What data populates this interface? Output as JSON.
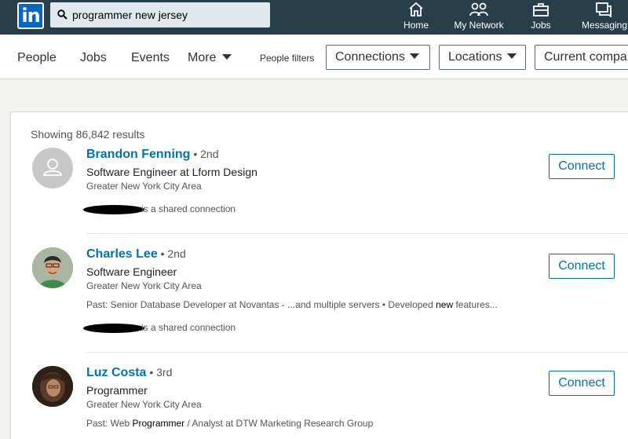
{
  "topnav": {
    "logo": "in",
    "search": {
      "value": "programmer new jersey"
    },
    "items": [
      {
        "label": "Home",
        "icon": "home-icon"
      },
      {
        "label": "My Network",
        "icon": "network-icon"
      },
      {
        "label": "Jobs",
        "icon": "briefcase-icon"
      },
      {
        "label": "Messaging",
        "icon": "messaging-icon"
      }
    ]
  },
  "subnav": {
    "tabs": [
      "People",
      "Jobs",
      "Events",
      "More"
    ],
    "filters_label": "People filters",
    "dropdowns": [
      "Connections",
      "Locations",
      "Current compa"
    ]
  },
  "results": {
    "count_text": "Showing 86,842 results",
    "items": [
      {
        "name": "Brandon Fenning",
        "degree": " • 2nd",
        "title": "Software Engineer at Lform Design",
        "location": "Greater New York City Area",
        "shared": "is a shared connection",
        "connect": "Connect"
      },
      {
        "name": "Charles Lee",
        "degree": " • 2nd",
        "title": "Software Engineer",
        "location": "Greater New York City Area",
        "past_a": "Past: Senior Database Developer at Novantas - ...and multiple servers • Developed ",
        "past_b": "new",
        "past_c": " features...",
        "shared": "is a shared connection",
        "connect": "Connect"
      },
      {
        "name": "Luz Costa",
        "degree": " • 3rd",
        "title": "Programmer",
        "location": "Greater New York City Area",
        "past_a": "Past: Web ",
        "past_b": "Programmer",
        "past_c": " / Analyst at DTW Marketing Research Group",
        "connect": "Connect"
      }
    ]
  },
  "colors": {
    "nav_bg": "#283e4a",
    "accent": "#0073b1"
  }
}
